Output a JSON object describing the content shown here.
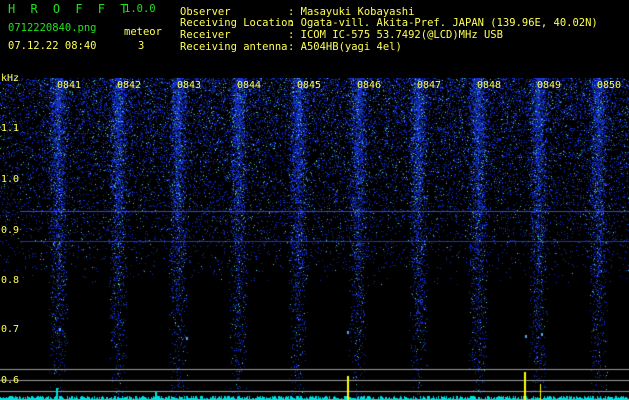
{
  "app": {
    "name": "H R O F F T",
    "version": "1.0.0"
  },
  "file": {
    "name": "0712220840.png",
    "datetime": "07.12.22 08:40"
  },
  "meteor": {
    "label": "meteor",
    "count": "3"
  },
  "info": {
    "observer": {
      "label": "Observer",
      "value": ": Masayuki Kobayashi"
    },
    "location": {
      "label": "Receiving Location",
      "value": ": Ogata-vill. Akita-Pref. JAPAN (139.96E, 40.02N)"
    },
    "receiver": {
      "label": "Receiver",
      "value": ": ICOM IC-575 53.7492(@LCD)MHz USB"
    },
    "antenna": {
      "label": "Receiving antenna",
      "value": ": A504HB(yagi 4el)"
    }
  },
  "spectrogram": {
    "unit": "kHz",
    "freq_ticks": [
      "1.1",
      "1.0",
      "0.9",
      "0.8",
      "0.7",
      "0.6"
    ],
    "time_ticks": [
      "0841",
      "0842",
      "0843",
      "0844",
      "0845",
      "0846",
      "0847",
      "0848",
      "0849",
      "0850"
    ],
    "colors": {
      "noise": "#1a2cd6",
      "grid": "#cccccc",
      "meteor_head": "#ffff00",
      "level": "#00dede"
    }
  }
}
